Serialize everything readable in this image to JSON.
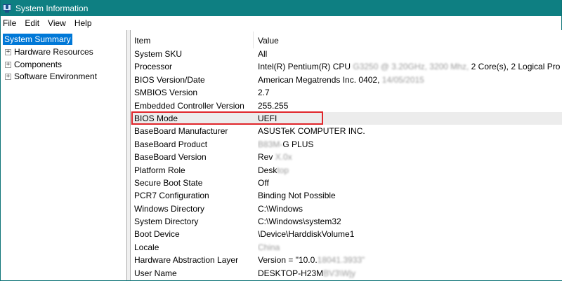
{
  "window": {
    "title": "System Information"
  },
  "menubar": {
    "items": [
      "File",
      "Edit",
      "View",
      "Help"
    ]
  },
  "tree": {
    "root": "System Summary",
    "children": [
      "Hardware Resources",
      "Components",
      "Software Environment"
    ],
    "expander_symbol": "+"
  },
  "table": {
    "headers": [
      "Item",
      "Value"
    ],
    "rows": [
      {
        "item": "System SKU",
        "value": "All"
      },
      {
        "item": "Processor",
        "value": "Intel(R) Pentium(R) CPU",
        "value_blurred": "G3250 @ 3.20GHz, 3200 Mhz,",
        "value_tail": "2 Core(s), 2 Logical Pro..."
      },
      {
        "item": "BIOS Version/Date",
        "value": "American Megatrends Inc. 0402,",
        "value_blurred": "14/05/2015"
      },
      {
        "item": "SMBIOS Version",
        "value": "2.7"
      },
      {
        "item": "Embedded Controller Version",
        "value": "255.255"
      },
      {
        "item": "BIOS Mode",
        "value": "UEFI"
      },
      {
        "item": "BaseBoard Manufacturer",
        "value": "ASUSTeK COMPUTER INC."
      },
      {
        "item": "BaseBoard Product",
        "value_blurred": "B83M-",
        "value": "G PLUS"
      },
      {
        "item": "BaseBoard Version",
        "value": "Rev",
        "value_blurred": "X.0x"
      },
      {
        "item": "Platform Role",
        "value": "Desk",
        "value_blurred": "top"
      },
      {
        "item": "Secure Boot State",
        "value": "Off"
      },
      {
        "item": "PCR7 Configuration",
        "value": "Binding Not Possible"
      },
      {
        "item": "Windows Directory",
        "value": "C:\\Windows"
      },
      {
        "item": "System Directory",
        "value": "C:\\Windows\\system32"
      },
      {
        "item": "Boot Device",
        "value": "\\Device\\HarddiskVolume1"
      },
      {
        "item": "Locale",
        "value_blurred": "China"
      },
      {
        "item": "Hardware Abstraction Layer",
        "value": "Version = \"10.0.",
        "value_blurred": "18041.3933\""
      },
      {
        "item": "User Name",
        "value": "DESKTOP-H23M",
        "value_blurred": "BV3\\Wjy"
      }
    ],
    "selected_index": 5
  },
  "colors": {
    "titlebar": "#0e7f82",
    "selection": "#0078d7",
    "highlight_box": "#e0262b"
  }
}
